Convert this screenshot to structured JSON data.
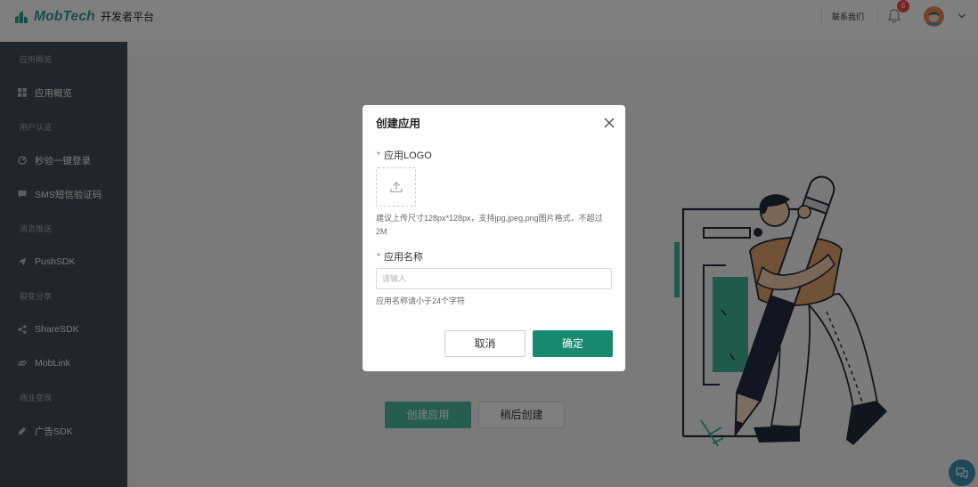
{
  "header": {
    "logo_text": "MobTech",
    "platform_name": "开发者平台",
    "contact_link": "联系我们",
    "notification_count": "5",
    "icons": {
      "logo": "mobtech-logo-icon",
      "notifications": "bell-icon",
      "avatar": "user-avatar",
      "menu": "chevron-down-icon"
    }
  },
  "sidebar": {
    "groups": [
      {
        "title": "应用概览",
        "items": [
          {
            "label": "应用概览",
            "icon": "grid-icon"
          }
        ]
      },
      {
        "title": "用户认证",
        "items": [
          {
            "label": "秒验一键登录",
            "icon": "gauge-icon"
          },
          {
            "label": "SMS短信验证码",
            "icon": "message-icon"
          }
        ]
      },
      {
        "title": "消息推送",
        "items": [
          {
            "label": "PushSDK",
            "icon": "send-icon"
          }
        ]
      },
      {
        "title": "裂变分享",
        "items": [
          {
            "label": "ShareSDK",
            "icon": "share-icon"
          },
          {
            "label": "MobLink",
            "icon": "link-icon"
          }
        ]
      },
      {
        "title": "商业变现",
        "items": [
          {
            "label": "广告SDK",
            "icon": "ad-icon"
          }
        ]
      }
    ]
  },
  "main": {
    "create_button": "创建应用",
    "later_button": "稍后创建",
    "illustration": "person-with-pencil-illustration",
    "chat_icon": "chat-icon"
  },
  "modal": {
    "title": "创建应用",
    "close_icon": "close-icon",
    "required_mark": "*",
    "logo_label": "应用LOGO",
    "upload_icon": "upload-icon",
    "logo_hint": "建议上传尺寸128px*128px，支持jpg,jpeg,png图片格式，不超过2M",
    "name_label": "应用名称",
    "name_placeholder": "请输入",
    "name_hint": "应用名称请小于24个字符",
    "cancel_button": "取消",
    "confirm_button": "确定"
  },
  "colors": {
    "accent": "#17896f",
    "badge": "#f0483e",
    "sidebar": "#434d5a",
    "overlay": "rgba(0,0,0,0.5)",
    "required": "#f04a3e",
    "logo": "#2aa08c"
  }
}
